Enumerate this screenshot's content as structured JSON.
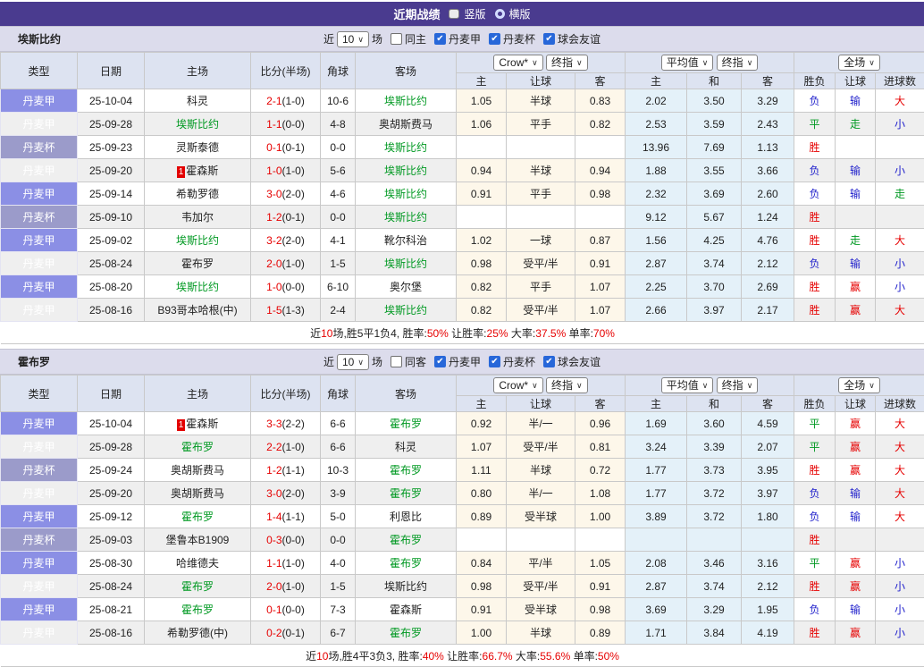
{
  "topbar": {
    "title": "近期战绩",
    "options": [
      {
        "label": "竖版",
        "selected": true
      },
      {
        "label": "横版",
        "selected": false
      }
    ]
  },
  "icons": {
    "check": "✔",
    "chevron_down": "∨"
  },
  "colors": {
    "header_bar": "#4a3b8f",
    "result_red": "#e60000",
    "result_green": "#009922",
    "result_blue": "#2222cc",
    "league_cell": "#8b8fe5",
    "cup_cell": "#9b9bca",
    "crow_bg": "#fdf7ea",
    "avg_bg": "#e4f1f9",
    "row_alt": "#efefef",
    "focus_team_green": "#009922",
    "score_red": "#e60000",
    "badge_red": "#e30000"
  },
  "columns": {
    "type": "类型",
    "date": "日期",
    "home": "主场",
    "score": "比分(半场)",
    "corner": "角球",
    "away": "客场",
    "h_home": "主",
    "h_handicap": "让球",
    "h_away": "客",
    "a_home": "主",
    "a_draw": "和",
    "a_away": "客",
    "wdl": "胜负",
    "handicap_result": "让球",
    "goals": "进球数"
  },
  "tables": [
    {
      "team": "埃斯比约",
      "controls": {
        "recent_label": "近",
        "count": "10",
        "matches_label": "场",
        "same_label": "同主",
        "leagues": [
          "丹麦甲",
          "丹麦杯",
          "球会友谊"
        ]
      },
      "selects": {
        "source": "Crow*",
        "stage1": "终指",
        "avg": "平均值",
        "stage2": "终指",
        "scope": "全场"
      },
      "rows": [
        {
          "type": "丹麦甲",
          "cup": false,
          "date": "25-10-04",
          "home": {
            "name": "科灵",
            "focus": false,
            "badge": ""
          },
          "score": {
            "ft": "2-1",
            "ht": "(1-0)"
          },
          "corner": "10-6",
          "away": {
            "name": "埃斯比约",
            "focus": true
          },
          "crow": [
            "1.05",
            "半球",
            "0.83"
          ],
          "avg": [
            "2.02",
            "3.50",
            "3.29"
          ],
          "result": [
            {
              "t": "负",
              "c": "blue"
            },
            {
              "t": "输",
              "c": "blue"
            },
            {
              "t": "大",
              "c": "red"
            }
          ]
        },
        {
          "type": "丹麦甲",
          "cup": false,
          "date": "25-09-28",
          "home": {
            "name": "埃斯比约",
            "focus": true,
            "badge": ""
          },
          "score": {
            "ft": "1-1",
            "ht": "(0-0)"
          },
          "corner": "4-8",
          "away": {
            "name": "奥胡斯费马",
            "focus": false
          },
          "crow": [
            "1.06",
            "平手",
            "0.82"
          ],
          "avg": [
            "2.53",
            "3.59",
            "2.43"
          ],
          "result": [
            {
              "t": "平",
              "c": "green"
            },
            {
              "t": "走",
              "c": "green"
            },
            {
              "t": "小",
              "c": "blue"
            }
          ]
        },
        {
          "type": "丹麦杯",
          "cup": true,
          "date": "25-09-23",
          "home": {
            "name": "灵斯泰德",
            "focus": false,
            "badge": ""
          },
          "score": {
            "ft": "0-1",
            "ht": "(0-1)"
          },
          "corner": "0-0",
          "away": {
            "name": "埃斯比约",
            "focus": true
          },
          "crow": [
            "",
            "",
            ""
          ],
          "avg": [
            "13.96",
            "7.69",
            "1.13"
          ],
          "result": [
            {
              "t": "胜",
              "c": "red"
            },
            {
              "t": "",
              "c": ""
            },
            {
              "t": "",
              "c": ""
            }
          ]
        },
        {
          "type": "丹麦甲",
          "cup": false,
          "date": "25-09-20",
          "home": {
            "name": "霍森斯",
            "focus": false,
            "badge": "1"
          },
          "score": {
            "ft": "1-0",
            "ht": "(1-0)"
          },
          "corner": "5-6",
          "away": {
            "name": "埃斯比约",
            "focus": true
          },
          "crow": [
            "0.94",
            "半球",
            "0.94"
          ],
          "avg": [
            "1.88",
            "3.55",
            "3.66"
          ],
          "result": [
            {
              "t": "负",
              "c": "blue"
            },
            {
              "t": "输",
              "c": "blue"
            },
            {
              "t": "小",
              "c": "blue"
            }
          ]
        },
        {
          "type": "丹麦甲",
          "cup": false,
          "date": "25-09-14",
          "home": {
            "name": "希勒罗德",
            "focus": false,
            "badge": ""
          },
          "score": {
            "ft": "3-0",
            "ht": "(2-0)"
          },
          "corner": "4-6",
          "away": {
            "name": "埃斯比约",
            "focus": true
          },
          "crow": [
            "0.91",
            "平手",
            "0.98"
          ],
          "avg": [
            "2.32",
            "3.69",
            "2.60"
          ],
          "result": [
            {
              "t": "负",
              "c": "blue"
            },
            {
              "t": "输",
              "c": "blue"
            },
            {
              "t": "走",
              "c": "green"
            }
          ]
        },
        {
          "type": "丹麦杯",
          "cup": true,
          "date": "25-09-10",
          "home": {
            "name": "韦加尔",
            "focus": false,
            "badge": ""
          },
          "score": {
            "ft": "1-2",
            "ht": "(0-1)"
          },
          "corner": "0-0",
          "away": {
            "name": "埃斯比约",
            "focus": true
          },
          "crow": [
            "",
            "",
            ""
          ],
          "avg": [
            "9.12",
            "5.67",
            "1.24"
          ],
          "result": [
            {
              "t": "胜",
              "c": "red"
            },
            {
              "t": "",
              "c": ""
            },
            {
              "t": "",
              "c": ""
            }
          ]
        },
        {
          "type": "丹麦甲",
          "cup": false,
          "date": "25-09-02",
          "home": {
            "name": "埃斯比约",
            "focus": true,
            "badge": ""
          },
          "score": {
            "ft": "3-2",
            "ht": "(2-0)"
          },
          "corner": "4-1",
          "away": {
            "name": "靴尔科治",
            "focus": false
          },
          "crow": [
            "1.02",
            "一球",
            "0.87"
          ],
          "avg": [
            "1.56",
            "4.25",
            "4.76"
          ],
          "result": [
            {
              "t": "胜",
              "c": "red"
            },
            {
              "t": "走",
              "c": "green"
            },
            {
              "t": "大",
              "c": "red"
            }
          ]
        },
        {
          "type": "丹麦甲",
          "cup": false,
          "date": "25-08-24",
          "home": {
            "name": "霍布罗",
            "focus": false,
            "badge": ""
          },
          "score": {
            "ft": "2-0",
            "ht": "(1-0)"
          },
          "corner": "1-5",
          "away": {
            "name": "埃斯比约",
            "focus": true
          },
          "crow": [
            "0.98",
            "受平/半",
            "0.91"
          ],
          "avg": [
            "2.87",
            "3.74",
            "2.12"
          ],
          "result": [
            {
              "t": "负",
              "c": "blue"
            },
            {
              "t": "输",
              "c": "blue"
            },
            {
              "t": "小",
              "c": "blue"
            }
          ]
        },
        {
          "type": "丹麦甲",
          "cup": false,
          "date": "25-08-20",
          "home": {
            "name": "埃斯比约",
            "focus": true,
            "badge": ""
          },
          "score": {
            "ft": "1-0",
            "ht": "(0-0)"
          },
          "corner": "6-10",
          "away": {
            "name": "奥尔堡",
            "focus": false
          },
          "crow": [
            "0.82",
            "平手",
            "1.07"
          ],
          "avg": [
            "2.25",
            "3.70",
            "2.69"
          ],
          "result": [
            {
              "t": "胜",
              "c": "red"
            },
            {
              "t": "赢",
              "c": "red"
            },
            {
              "t": "小",
              "c": "blue"
            }
          ]
        },
        {
          "type": "丹麦甲",
          "cup": false,
          "date": "25-08-16",
          "home": {
            "name": "B93哥本哈根(中)",
            "focus": false,
            "badge": ""
          },
          "score": {
            "ft": "1-5",
            "ht": "(1-3)"
          },
          "corner": "2-4",
          "away": {
            "name": "埃斯比约",
            "focus": true
          },
          "crow": [
            "0.82",
            "受平/半",
            "1.07"
          ],
          "avg": [
            "2.66",
            "3.97",
            "2.17"
          ],
          "result": [
            {
              "t": "胜",
              "c": "red"
            },
            {
              "t": "赢",
              "c": "red"
            },
            {
              "t": "大",
              "c": "red"
            }
          ]
        }
      ],
      "summary": [
        "近",
        "10",
        "场,胜5平1负4, 胜率:",
        "50%",
        " 让胜率:",
        "25%",
        " 大率:",
        "37.5%",
        " 单率:",
        "70%"
      ]
    },
    {
      "team": "霍布罗",
      "controls": {
        "recent_label": "近",
        "count": "10",
        "matches_label": "场",
        "same_label": "同客",
        "leagues": [
          "丹麦甲",
          "丹麦杯",
          "球会友谊"
        ]
      },
      "selects": {
        "source": "Crow*",
        "stage1": "终指",
        "avg": "平均值",
        "stage2": "终指",
        "scope": "全场"
      },
      "rows": [
        {
          "type": "丹麦甲",
          "cup": false,
          "date": "25-10-04",
          "home": {
            "name": "霍森斯",
            "focus": false,
            "badge": "1"
          },
          "score": {
            "ft": "3-3",
            "ht": "(2-2)"
          },
          "corner": "6-6",
          "away": {
            "name": "霍布罗",
            "focus": true
          },
          "crow": [
            "0.92",
            "半/一",
            "0.96"
          ],
          "avg": [
            "1.69",
            "3.60",
            "4.59"
          ],
          "result": [
            {
              "t": "平",
              "c": "green"
            },
            {
              "t": "赢",
              "c": "red"
            },
            {
              "t": "大",
              "c": "red"
            }
          ]
        },
        {
          "type": "丹麦甲",
          "cup": false,
          "date": "25-09-28",
          "home": {
            "name": "霍布罗",
            "focus": true,
            "badge": ""
          },
          "score": {
            "ft": "2-2",
            "ht": "(1-0)"
          },
          "corner": "6-6",
          "away": {
            "name": "科灵",
            "focus": false
          },
          "crow": [
            "1.07",
            "受平/半",
            "0.81"
          ],
          "avg": [
            "3.24",
            "3.39",
            "2.07"
          ],
          "result": [
            {
              "t": "平",
              "c": "green"
            },
            {
              "t": "赢",
              "c": "red"
            },
            {
              "t": "大",
              "c": "red"
            }
          ]
        },
        {
          "type": "丹麦杯",
          "cup": true,
          "date": "25-09-24",
          "home": {
            "name": "奥胡斯费马",
            "focus": false,
            "badge": ""
          },
          "score": {
            "ft": "1-2",
            "ht": "(1-1)"
          },
          "corner": "10-3",
          "away": {
            "name": "霍布罗",
            "focus": true
          },
          "crow": [
            "1.11",
            "半球",
            "0.72"
          ],
          "avg": [
            "1.77",
            "3.73",
            "3.95"
          ],
          "result": [
            {
              "t": "胜",
              "c": "red"
            },
            {
              "t": "赢",
              "c": "red"
            },
            {
              "t": "大",
              "c": "red"
            }
          ]
        },
        {
          "type": "丹麦甲",
          "cup": false,
          "date": "25-09-20",
          "home": {
            "name": "奥胡斯费马",
            "focus": false,
            "badge": ""
          },
          "score": {
            "ft": "3-0",
            "ht": "(2-0)"
          },
          "corner": "3-9",
          "away": {
            "name": "霍布罗",
            "focus": true
          },
          "crow": [
            "0.80",
            "半/一",
            "1.08"
          ],
          "avg": [
            "1.77",
            "3.72",
            "3.97"
          ],
          "result": [
            {
              "t": "负",
              "c": "blue"
            },
            {
              "t": "输",
              "c": "blue"
            },
            {
              "t": "大",
              "c": "red"
            }
          ]
        },
        {
          "type": "丹麦甲",
          "cup": false,
          "date": "25-09-12",
          "home": {
            "name": "霍布罗",
            "focus": true,
            "badge": ""
          },
          "score": {
            "ft": "1-4",
            "ht": "(1-1)"
          },
          "corner": "5-0",
          "away": {
            "name": "利恩比",
            "focus": false
          },
          "crow": [
            "0.89",
            "受半球",
            "1.00"
          ],
          "avg": [
            "3.89",
            "3.72",
            "1.80"
          ],
          "result": [
            {
              "t": "负",
              "c": "blue"
            },
            {
              "t": "输",
              "c": "blue"
            },
            {
              "t": "大",
              "c": "red"
            }
          ]
        },
        {
          "type": "丹麦杯",
          "cup": true,
          "date": "25-09-03",
          "home": {
            "name": "堡鲁本B1909",
            "focus": false,
            "badge": ""
          },
          "score": {
            "ft": "0-3",
            "ht": "(0-0)"
          },
          "corner": "0-0",
          "away": {
            "name": "霍布罗",
            "focus": true
          },
          "crow": [
            "",
            "",
            ""
          ],
          "avg": [
            "",
            "",
            ""
          ],
          "result": [
            {
              "t": "胜",
              "c": "red"
            },
            {
              "t": "",
              "c": ""
            },
            {
              "t": "",
              "c": ""
            }
          ]
        },
        {
          "type": "丹麦甲",
          "cup": false,
          "date": "25-08-30",
          "home": {
            "name": "哈维德夫",
            "focus": false,
            "badge": ""
          },
          "score": {
            "ft": "1-1",
            "ht": "(1-0)"
          },
          "corner": "4-0",
          "away": {
            "name": "霍布罗",
            "focus": true
          },
          "crow": [
            "0.84",
            "平/半",
            "1.05"
          ],
          "avg": [
            "2.08",
            "3.46",
            "3.16"
          ],
          "result": [
            {
              "t": "平",
              "c": "green"
            },
            {
              "t": "赢",
              "c": "red"
            },
            {
              "t": "小",
              "c": "blue"
            }
          ]
        },
        {
          "type": "丹麦甲",
          "cup": false,
          "date": "25-08-24",
          "home": {
            "name": "霍布罗",
            "focus": true,
            "badge": ""
          },
          "score": {
            "ft": "2-0",
            "ht": "(1-0)"
          },
          "corner": "1-5",
          "away": {
            "name": "埃斯比约",
            "focus": false
          },
          "crow": [
            "0.98",
            "受平/半",
            "0.91"
          ],
          "avg": [
            "2.87",
            "3.74",
            "2.12"
          ],
          "result": [
            {
              "t": "胜",
              "c": "red"
            },
            {
              "t": "赢",
              "c": "red"
            },
            {
              "t": "小",
              "c": "blue"
            }
          ]
        },
        {
          "type": "丹麦甲",
          "cup": false,
          "date": "25-08-21",
          "home": {
            "name": "霍布罗",
            "focus": true,
            "badge": ""
          },
          "score": {
            "ft": "0-1",
            "ht": "(0-0)"
          },
          "corner": "7-3",
          "away": {
            "name": "霍森斯",
            "focus": false
          },
          "crow": [
            "0.91",
            "受半球",
            "0.98"
          ],
          "avg": [
            "3.69",
            "3.29",
            "1.95"
          ],
          "result": [
            {
              "t": "负",
              "c": "blue"
            },
            {
              "t": "输",
              "c": "blue"
            },
            {
              "t": "小",
              "c": "blue"
            }
          ]
        },
        {
          "type": "丹麦甲",
          "cup": false,
          "date": "25-08-16",
          "home": {
            "name": "希勒罗德(中)",
            "focus": false,
            "badge": ""
          },
          "score": {
            "ft": "0-2",
            "ht": "(0-1)"
          },
          "corner": "6-7",
          "away": {
            "name": "霍布罗",
            "focus": true
          },
          "crow": [
            "1.00",
            "半球",
            "0.89"
          ],
          "avg": [
            "1.71",
            "3.84",
            "4.19"
          ],
          "result": [
            {
              "t": "胜",
              "c": "red"
            },
            {
              "t": "赢",
              "c": "red"
            },
            {
              "t": "小",
              "c": "blue"
            }
          ]
        }
      ],
      "summary": [
        "近",
        "10",
        "场,胜4平3负3, 胜率:",
        "40%",
        " 让胜率:",
        "66.7%",
        " 大率:",
        "55.6%",
        " 单率:",
        "50%"
      ]
    }
  ]
}
